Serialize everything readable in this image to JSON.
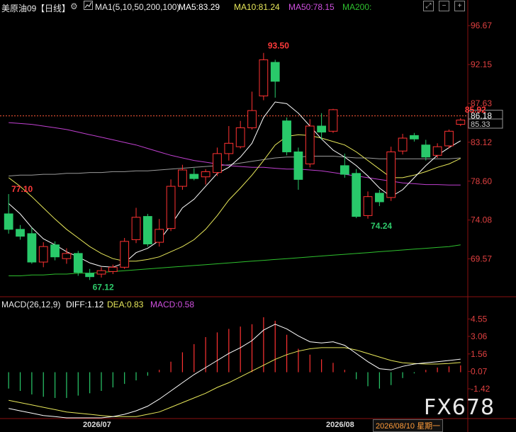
{
  "header": {
    "symbol": "美原油09",
    "period": "【日线】",
    "ma_group": "MA1(5,10,50,200,100)",
    "ma5": "MA5:83.29",
    "ma10": "MA10:81.24",
    "ma50": "MA50:78.15",
    "ma200": "MA200:",
    "icons": [
      "settings-icon",
      "chart-icon",
      "fullscreen-icon",
      "minus-icon",
      "plus-icon"
    ]
  },
  "macd_header": {
    "title": "MACD(26,12,9)",
    "diff": "DIFF:1.12",
    "dea": "DEA:0.83",
    "macd": "MACD:0.58"
  },
  "footer": {
    "date1": "2026/07",
    "date2": "2026/08",
    "current": "2026/08/10 星期一"
  },
  "watermark": "FX678",
  "colors": {
    "up": "#ff3232",
    "down": "#29c96a",
    "ma5": "#ffffff",
    "ma10": "#e8e85a",
    "ma50": "#c040d0",
    "ma200": "#2ec02e",
    "ma100": "#9a9a9a",
    "dea": "#e8e85a",
    "diff": "#ffffff"
  },
  "chart_data": [
    {
      "type": "candlestick",
      "y_ticks": [
        "96.67",
        "92.15",
        "87.63",
        "83.12",
        "78.60",
        "74.08",
        "69.57"
      ],
      "ylim": [
        65.5,
        98.0
      ],
      "price_line": "86.18",
      "last_price": "85.33",
      "annotations": [
        "93.50",
        "85.92",
        "77.10",
        "67.12",
        "74.24"
      ],
      "candles": [
        {
          "o": 74.8,
          "h": 77.1,
          "l": 72.5,
          "c": 73.0
        },
        {
          "o": 73.0,
          "h": 73.5,
          "l": 71.8,
          "c": 72.2
        },
        {
          "o": 72.5,
          "h": 73.2,
          "l": 69.0,
          "c": 69.2
        },
        {
          "o": 69.2,
          "h": 71.5,
          "l": 68.6,
          "c": 71.0
        },
        {
          "o": 71.2,
          "h": 71.6,
          "l": 69.4,
          "c": 69.8
        },
        {
          "o": 69.6,
          "h": 70.8,
          "l": 69.0,
          "c": 70.2
        },
        {
          "o": 70.2,
          "h": 70.5,
          "l": 67.6,
          "c": 68.0
        },
        {
          "o": 67.9,
          "h": 68.4,
          "l": 67.12,
          "c": 67.5
        },
        {
          "o": 67.8,
          "h": 68.6,
          "l": 67.4,
          "c": 68.2
        },
        {
          "o": 68.1,
          "h": 68.9,
          "l": 67.8,
          "c": 68.6
        },
        {
          "o": 68.6,
          "h": 72.0,
          "l": 68.4,
          "c": 71.6
        },
        {
          "o": 71.8,
          "h": 75.5,
          "l": 71.4,
          "c": 74.4
        },
        {
          "o": 74.5,
          "h": 74.8,
          "l": 71.0,
          "c": 71.3
        },
        {
          "o": 71.5,
          "h": 74.2,
          "l": 71.0,
          "c": 73.0
        },
        {
          "o": 73.1,
          "h": 78.8,
          "l": 72.8,
          "c": 78.0
        },
        {
          "o": 78.0,
          "h": 80.5,
          "l": 77.6,
          "c": 79.9
        },
        {
          "o": 79.4,
          "h": 80.1,
          "l": 78.7,
          "c": 78.9
        },
        {
          "o": 79.1,
          "h": 80.0,
          "l": 78.2,
          "c": 79.7
        },
        {
          "o": 79.6,
          "h": 82.5,
          "l": 79.2,
          "c": 81.8
        },
        {
          "o": 81.8,
          "h": 85.0,
          "l": 81.0,
          "c": 83.0
        },
        {
          "o": 82.6,
          "h": 85.6,
          "l": 82.4,
          "c": 84.8
        },
        {
          "o": 84.8,
          "h": 89.0,
          "l": 84.6,
          "c": 86.8
        },
        {
          "o": 88.5,
          "h": 93.5,
          "l": 88.0,
          "c": 92.7
        },
        {
          "o": 92.4,
          "h": 92.7,
          "l": 88.3,
          "c": 90.2
        },
        {
          "o": 85.6,
          "h": 86.0,
          "l": 81.6,
          "c": 82.0
        },
        {
          "o": 82.0,
          "h": 82.5,
          "l": 77.6,
          "c": 78.8
        },
        {
          "o": 80.6,
          "h": 85.8,
          "l": 80.2,
          "c": 85.0
        },
        {
          "o": 85.0,
          "h": 86.5,
          "l": 83.4,
          "c": 84.3
        },
        {
          "o": 84.4,
          "h": 87.0,
          "l": 84.2,
          "c": 86.9
        },
        {
          "o": 80.4,
          "h": 81.8,
          "l": 79.0,
          "c": 79.4
        },
        {
          "o": 79.5,
          "h": 80.0,
          "l": 74.3,
          "c": 74.5
        },
        {
          "o": 74.6,
          "h": 77.4,
          "l": 74.24,
          "c": 76.8
        },
        {
          "o": 77.2,
          "h": 77.6,
          "l": 75.7,
          "c": 76.2
        },
        {
          "o": 76.7,
          "h": 82.6,
          "l": 76.3,
          "c": 82.0
        },
        {
          "o": 82.1,
          "h": 84.1,
          "l": 81.7,
          "c": 83.6
        },
        {
          "o": 83.9,
          "h": 84.2,
          "l": 83.2,
          "c": 83.5
        },
        {
          "o": 82.8,
          "h": 83.4,
          "l": 81.0,
          "c": 81.4
        },
        {
          "o": 81.6,
          "h": 83.0,
          "l": 81.3,
          "c": 82.6
        },
        {
          "o": 82.7,
          "h": 84.6,
          "l": 82.4,
          "c": 84.4
        },
        {
          "o": 85.2,
          "h": 85.92,
          "l": 85.0,
          "c": 85.7
        }
      ],
      "ma5": [
        76.0,
        74.8,
        73.2,
        71.9,
        71.2,
        70.4,
        69.8,
        69.1,
        68.7,
        68.6,
        69.1,
        70.3,
        70.8,
        71.7,
        73.5,
        75.5,
        76.5,
        78.0,
        79.5,
        80.2,
        81.4,
        83.0,
        86.0,
        87.8,
        87.6,
        86.5,
        85.0,
        83.5,
        82.2,
        81.4,
        80.4,
        79.2,
        77.8,
        76.8,
        77.6,
        79.0,
        80.4,
        81.6,
        82.5,
        83.29
      ],
      "ma10": [
        79.0,
        78.0,
        76.8,
        75.5,
        74.2,
        73.0,
        72.0,
        71.0,
        70.2,
        69.6,
        69.3,
        69.3,
        69.5,
        69.8,
        70.4,
        71.0,
        71.8,
        73.0,
        74.6,
        76.4,
        77.8,
        79.3,
        81.0,
        82.8,
        83.8,
        84.0,
        83.9,
        83.6,
        83.2,
        82.8,
        82.0,
        81.0,
        80.0,
        79.0,
        79.0,
        79.3,
        79.7,
        80.2,
        80.6,
        81.24
      ],
      "ma50": [
        85.4,
        85.3,
        85.2,
        85.0,
        84.8,
        84.6,
        84.3,
        84.0,
        83.7,
        83.4,
        83.1,
        82.8,
        82.4,
        82.0,
        81.6,
        81.3,
        81.0,
        80.8,
        80.6,
        80.4,
        80.3,
        80.2,
        80.2,
        80.1,
        80.0,
        80.0,
        79.9,
        79.8,
        79.6,
        79.4,
        79.2,
        79.0,
        78.8,
        78.6,
        78.4,
        78.3,
        78.2,
        78.2,
        78.15,
        78.15
      ],
      "ma100": [
        79.2,
        79.3,
        79.3,
        79.4,
        79.4,
        79.5,
        79.5,
        79.6,
        79.6,
        79.7,
        79.7,
        79.8,
        79.8,
        79.9,
        80.0,
        80.1,
        80.2,
        80.3,
        80.4,
        80.5,
        80.7,
        80.9,
        81.1,
        81.3,
        81.4,
        81.4,
        81.5,
        81.5,
        81.5,
        81.4,
        81.3,
        81.3,
        81.2,
        81.2,
        81.2,
        81.2,
        81.2,
        81.2,
        81.2,
        81.3
      ],
      "ma200": [
        67.6,
        67.6,
        67.7,
        67.7,
        67.8,
        67.8,
        67.9,
        67.9,
        68.0,
        68.1,
        68.2,
        68.3,
        68.4,
        68.5,
        68.6,
        68.7,
        68.8,
        68.9,
        69.0,
        69.1,
        69.2,
        69.3,
        69.4,
        69.5,
        69.6,
        69.7,
        69.8,
        69.9,
        70.0,
        70.1,
        70.2,
        70.3,
        70.4,
        70.5,
        70.6,
        70.7,
        70.8,
        70.9,
        71.0,
        71.2
      ]
    },
    {
      "type": "macd",
      "y_ticks": [
        "4.55",
        "3.06",
        "1.56",
        "0.07",
        "-1.42"
      ],
      "ylim": [
        -3.9,
        5.3
      ],
      "histogram": [
        -1.4,
        -1.6,
        -1.9,
        -2.1,
        -2.2,
        -2.2,
        -2.0,
        -1.8,
        -1.6,
        -1.3,
        -1.0,
        -0.7,
        -0.3,
        0.2,
        0.9,
        1.7,
        2.4,
        3.0,
        3.4,
        3.7,
        3.9,
        4.1,
        4.7,
        4.4,
        3.2,
        2.0,
        1.5,
        1.1,
        0.8,
        0.2,
        -0.6,
        -1.2,
        -1.4,
        -1.1,
        -0.5,
        -0.1,
        0.2,
        0.4,
        0.5,
        0.58
      ],
      "diff": [
        -3.1,
        -3.3,
        -3.5,
        -3.7,
        -3.8,
        -3.9,
        -3.9,
        -3.9,
        -3.9,
        -3.8,
        -3.6,
        -3.3,
        -2.9,
        -2.3,
        -1.6,
        -0.9,
        -0.2,
        0.4,
        1.0,
        1.6,
        2.1,
        2.7,
        3.6,
        4.1,
        3.7,
        3.1,
        2.6,
        2.5,
        2.6,
        2.3,
        1.6,
        0.9,
        0.3,
        0.2,
        0.5,
        0.7,
        0.8,
        0.9,
        1.0,
        1.12
      ],
      "dea": [
        -2.4,
        -2.6,
        -2.8,
        -3.0,
        -3.2,
        -3.4,
        -3.5,
        -3.6,
        -3.7,
        -3.8,
        -3.8,
        -3.8,
        -3.6,
        -3.4,
        -3.0,
        -2.6,
        -2.2,
        -1.8,
        -1.3,
        -0.9,
        -0.4,
        0.1,
        0.6,
        1.1,
        1.5,
        1.8,
        2.0,
        2.1,
        2.1,
        2.1,
        1.9,
        1.6,
        1.3,
        1.0,
        0.8,
        0.75,
        0.7,
        0.7,
        0.75,
        0.83
      ]
    }
  ]
}
